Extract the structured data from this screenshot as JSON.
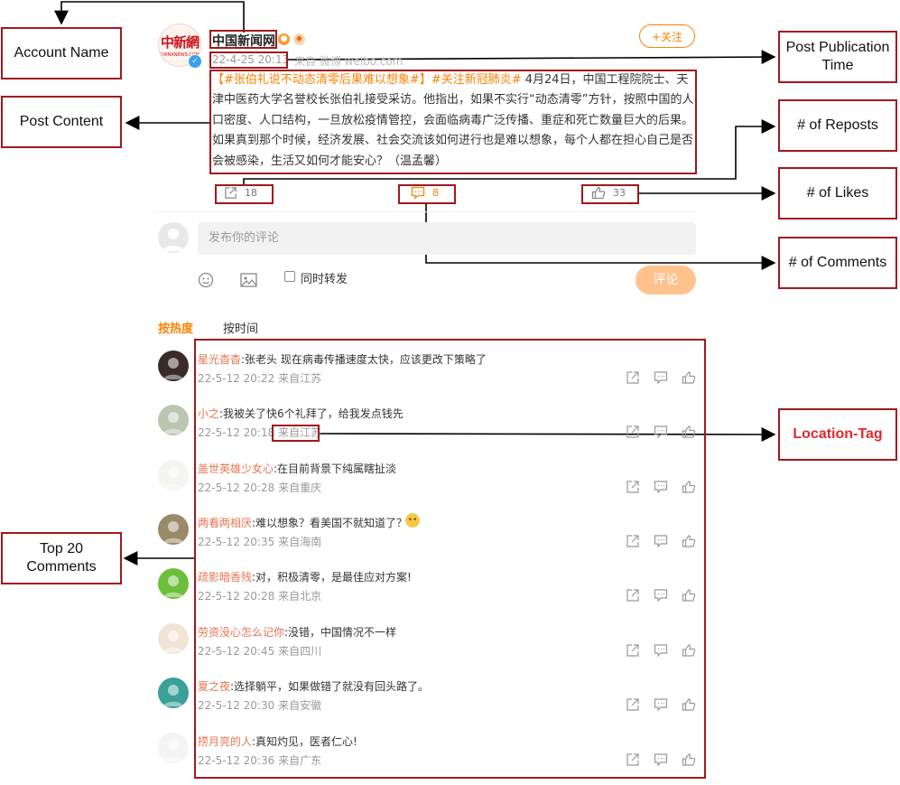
{
  "post": {
    "account_name": "中国新闻网",
    "logo_text": "中新網",
    "logo_subtext": "CHINANEWS.COM",
    "follow_label": "+关注",
    "timestamp": "22-4-25 20:13",
    "source": "来自 微博 weibo.com",
    "hashtag1": "【#张伯礼说不动态清零后果难以想象#】",
    "hashtag2": "#关注新冠肺炎#",
    "body": " 4月24日，中国工程院院士、天津中医药大学名誉校长张伯礼接受采访。他指出，如果不实行“动态清零”方针，按照中国的人口密度、人口结构，一旦放松疫情管控，会面临病毒广泛传播、重症和死亡数量巨大的后果。如果真到那个时候，经济发展、社会交流该如何进行也是难以想象，每个人都在担心自己是否会被感染，生活又如何才能安心？（温孟馨）",
    "reposts": "18",
    "comments": "8",
    "likes": "33"
  },
  "composer": {
    "placeholder": "发布你的评论",
    "also_repost_label": "同时转发",
    "submit_label": "评论"
  },
  "sort_tabs": {
    "hot": "按热度",
    "time": "按时间"
  },
  "comments": [
    {
      "user": "星光杳杳",
      "text": ":张老头 现在病毒传播速度太快，应该更改下策略了",
      "time": "22-5-12 20:22",
      "location": "来自江苏",
      "avatar_color": "#3a2a2a"
    },
    {
      "user": "小之",
      "text": ":我被关了快6个礼拜了，给我发点钱先",
      "time": "22-5-12 20:18",
      "location": "来自江苏",
      "avatar_color": "#b9c7b0"
    },
    {
      "user": "盖世英雄少女心",
      "text": ":在目前背景下纯属瞎扯淡",
      "time": "22-5-12 20:28",
      "location": "来自重庆",
      "avatar_color": "#f4f4f0"
    },
    {
      "user": "两看两相厌",
      "text": ":难以想象？看美国不就知道了？",
      "time": "22-5-12 20:35",
      "location": "来自海南",
      "avatar_color": "#9a8a6a"
    },
    {
      "user": "疏影暗香残",
      "text": ":对，积极清零，是最佳应对方案!",
      "time": "22-5-12 20:28",
      "location": "来自北京",
      "avatar_color": "#6cbf3a"
    },
    {
      "user": "劳资没心怎么记你",
      "text": ":没错，中国情况不一样",
      "time": "22-5-12 20:45",
      "location": "来自四川",
      "avatar_color": "#f1e3d6"
    },
    {
      "user": "夏之夜",
      "text": ":选择躺平，如果做错了就没有回头路了。",
      "time": "22-5-12 20:30",
      "location": "来自安徽",
      "avatar_color": "#3aa09a"
    },
    {
      "user": "捞月亮的人",
      "text": ":真知灼见，医者仁心!",
      "time": "22-5-12 20:36",
      "location": "来自广东",
      "avatar_color": "#f4f4f4"
    }
  ],
  "annotations": {
    "account_name": "Account Name",
    "publication_time_line1": "Post Publication",
    "publication_time_line2": "Time",
    "post_content": "Post Content",
    "reposts": "# of Reposts",
    "likes": "# of Likes",
    "comments": "# of Comments",
    "location_tag": "Location-Tag",
    "top_comments_line1": "Top 20",
    "top_comments_line2": "Comments"
  },
  "colors": {
    "annotation_border": "#a1181d",
    "weibo_orange": "#ff8200",
    "username": "#eb7350",
    "location_tag_text": "#e0272d"
  }
}
